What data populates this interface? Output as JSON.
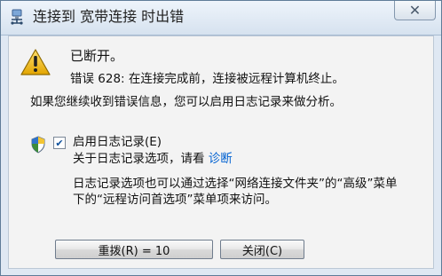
{
  "window": {
    "title": "连接到 宽带连接 时出错",
    "close_glyph": "✕"
  },
  "message": {
    "status": "已断开。",
    "error": "错误 628: 在连接完成前，连接被远程计算机终止。",
    "hint": "如果您继续收到错误信息，您可以启用日志记录来做分析。"
  },
  "logging": {
    "enabled": true,
    "checkbox_label": "启用日志记录(E)",
    "about_prefix": "关于日志记录选项，请看",
    "about_link": "诊断",
    "note_line1": "日志记录选项也可以通过选择“网络连接文件夹”的“高级”菜单",
    "note_line2": "下的“远程访问首选项”菜单项来访问。"
  },
  "buttons": {
    "retry": "重拨(R) = 10",
    "close": "关闭(C)"
  },
  "icons": {
    "title": "network-connection-icon",
    "warning": "warning-icon",
    "shield": "uac-shield-icon",
    "close": "close-icon"
  },
  "colors": {
    "link": "#0061d1",
    "warning_fill": "#f0c419",
    "title_bar": "#d6e2ef"
  }
}
